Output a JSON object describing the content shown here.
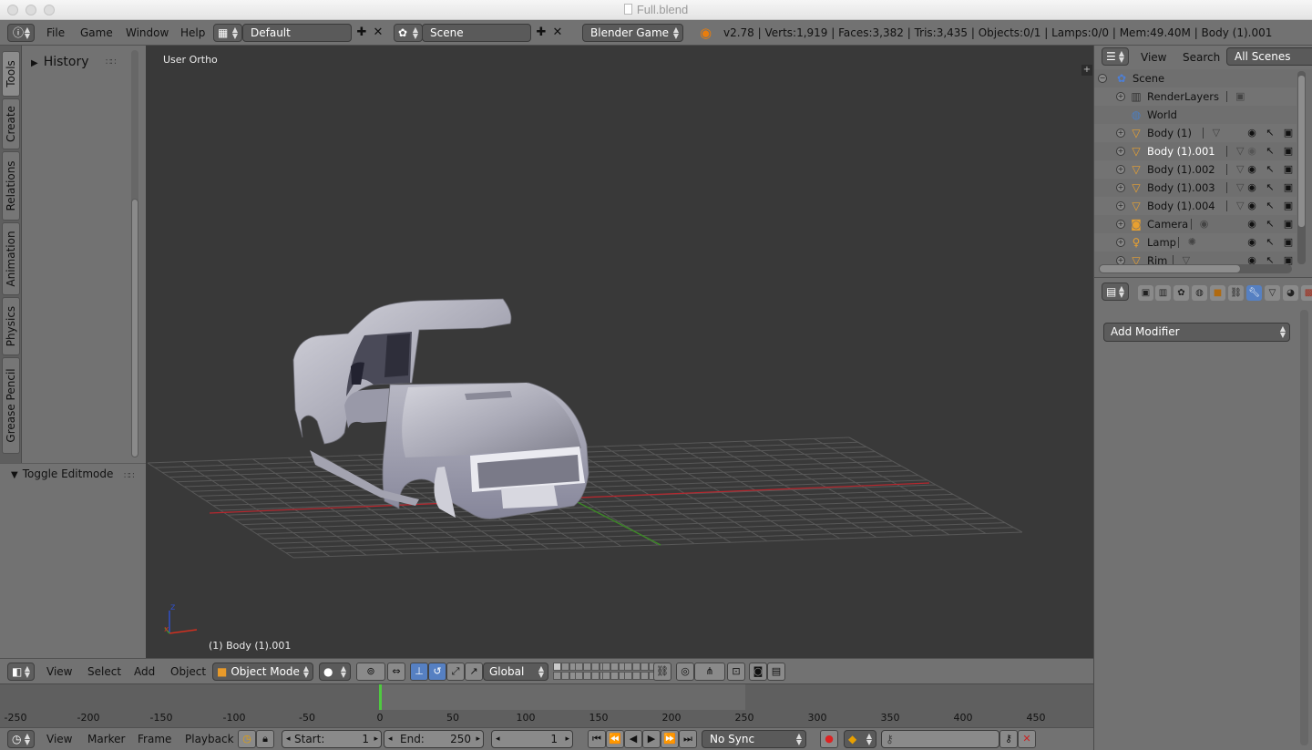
{
  "window": {
    "title": "Full.blend"
  },
  "info_header": {
    "menus": [
      "File",
      "Game",
      "Window",
      "Help"
    ],
    "screen_layout": "Default",
    "scene": "Scene",
    "render_engine": "Blender Game",
    "stats": "v2.78 | Verts:1,919 | Faces:3,382 | Tris:3,435 | Objects:0/1 | Lamps:0/0 | Mem:49.40M | Body (1).001"
  },
  "tool_shelf": {
    "tabs": [
      "Tools",
      "Create",
      "Relations",
      "Animation",
      "Physics",
      "Grease Pencil"
    ],
    "history_label": "History",
    "redo_panel_label": "Toggle Editmode"
  },
  "viewport": {
    "view_label": "User Ortho",
    "active_object_label": "(1) Body (1).001",
    "plus_label": "+"
  },
  "view3d_header": {
    "menus": [
      "View",
      "Select",
      "Add",
      "Object"
    ],
    "mode": "Object Mode",
    "orientation": "Global"
  },
  "timeline": {
    "ticks": [
      "-250",
      "-200",
      "-150",
      "-100",
      "-50",
      "0",
      "50",
      "100",
      "150",
      "200",
      "250",
      "300",
      "350",
      "400",
      "450"
    ],
    "current_frame_marker": 0,
    "menus": [
      "View",
      "Marker",
      "Frame",
      "Playback"
    ],
    "start_label": "Start:",
    "start_value": "1",
    "end_label": "End:",
    "end_value": "250",
    "current_frame": "1",
    "sync": "No Sync"
  },
  "outliner": {
    "menus": [
      "View",
      "Search"
    ],
    "filter": "All Scenes",
    "items": [
      {
        "name": "Scene",
        "icon": "scene-icon"
      },
      {
        "name": "RenderLayers",
        "icon": "render-layers-icon"
      },
      {
        "name": "World",
        "icon": "world-icon"
      },
      {
        "name": "Body (1)",
        "icon": "mesh-object-icon"
      },
      {
        "name": "Body (1).001",
        "icon": "mesh-object-icon",
        "selected": true
      },
      {
        "name": "Body (1).002",
        "icon": "mesh-object-icon"
      },
      {
        "name": "Body (1).003",
        "icon": "mesh-object-icon"
      },
      {
        "name": "Body (1).004",
        "icon": "mesh-object-icon"
      },
      {
        "name": "Camera",
        "icon": "camera-icon"
      },
      {
        "name": "Lamp",
        "icon": "lamp-icon"
      },
      {
        "name": "Rim",
        "icon": "mesh-object-icon"
      }
    ]
  },
  "properties": {
    "add_modifier_label": "Add Modifier",
    "active_tab": "modifiers-tab-icon"
  },
  "colors": {
    "accent_selected": "#5680c2",
    "playhead": "#4fc940",
    "x_axis": "#b3282f",
    "y_axis": "#3c8a25",
    "viewport_bg": "#393939"
  }
}
